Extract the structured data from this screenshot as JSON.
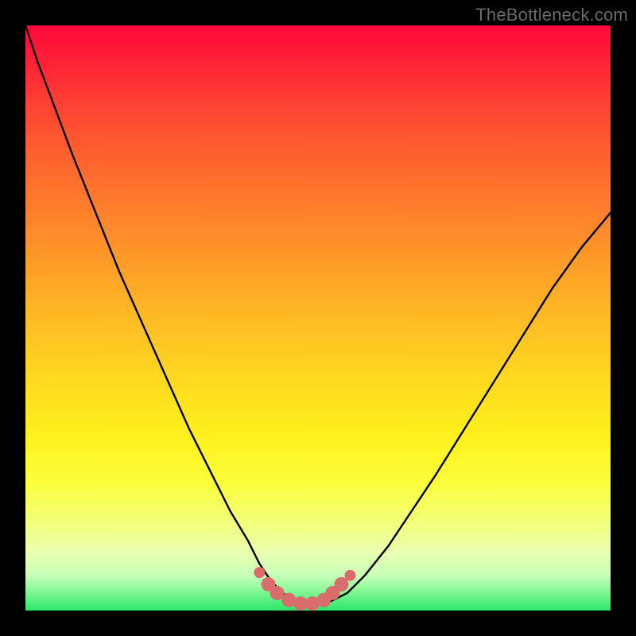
{
  "watermark": "TheBottleneck.com",
  "colors": {
    "frame": "#000000",
    "curve": "#000000",
    "marker": "#d96c6c",
    "gradient_top": "#ff0a3a",
    "gradient_bottom": "#28e66a"
  },
  "chart_data": {
    "type": "line",
    "title": "",
    "xlabel": "",
    "ylabel": "",
    "xlim": [
      0,
      100
    ],
    "ylim": [
      0,
      100
    ],
    "grid": false,
    "legend": false,
    "annotations": [],
    "series": [
      {
        "name": "bottleneck-curve",
        "x": [
          0,
          2,
          5,
          8,
          12,
          16,
          20,
          24,
          28,
          32,
          35,
          38,
          40,
          42,
          44,
          46,
          48,
          50,
          52,
          55,
          58,
          62,
          66,
          70,
          75,
          80,
          85,
          90,
          95,
          100
        ],
        "y": [
          100,
          94,
          86,
          78,
          68,
          58,
          49,
          40,
          31,
          23,
          17,
          12,
          8,
          5,
          3,
          1.5,
          1,
          1,
          1.5,
          3,
          6,
          11,
          17,
          23,
          31,
          39,
          47,
          55,
          62,
          68
        ]
      },
      {
        "name": "optimal-markers",
        "x": [
          40,
          41.5,
          43,
          45,
          47,
          49,
          51,
          52.5,
          54,
          55.5
        ],
        "y": [
          6.5,
          4.5,
          3,
          1.8,
          1.2,
          1.2,
          1.8,
          3,
          4.5,
          6
        ]
      }
    ]
  }
}
